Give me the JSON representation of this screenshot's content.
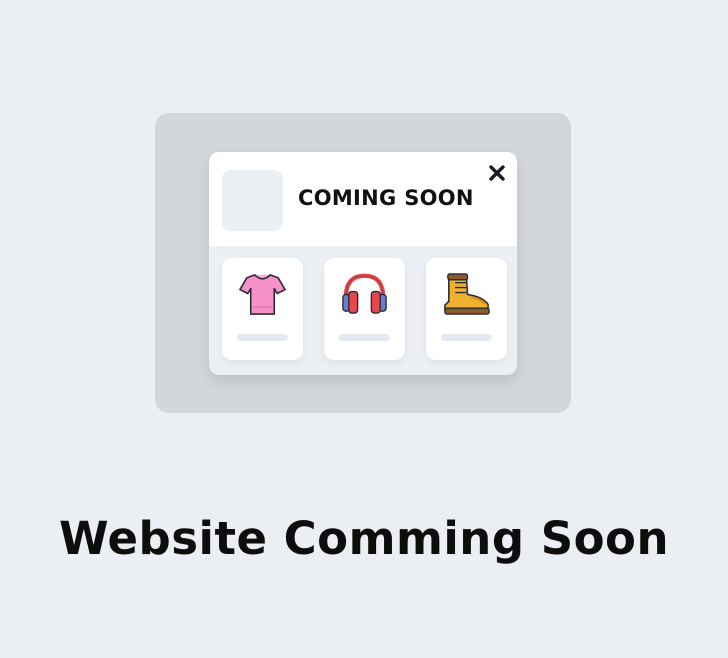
{
  "modal": {
    "title": "COMING SOON",
    "close_icon": "close-icon",
    "products": [
      {
        "icon": "tshirt-icon",
        "color": "#f28ec8"
      },
      {
        "icon": "headphones-icon",
        "color": "#e8464a"
      },
      {
        "icon": "boot-icon",
        "color": "#f0b030"
      }
    ]
  },
  "headline": "Website Comming Soon",
  "colors": {
    "page_background": "#ebeef3",
    "backdrop": "#d3d6db",
    "modal_body": "#eceff3",
    "card": "#ffffff",
    "text": "#111111"
  }
}
